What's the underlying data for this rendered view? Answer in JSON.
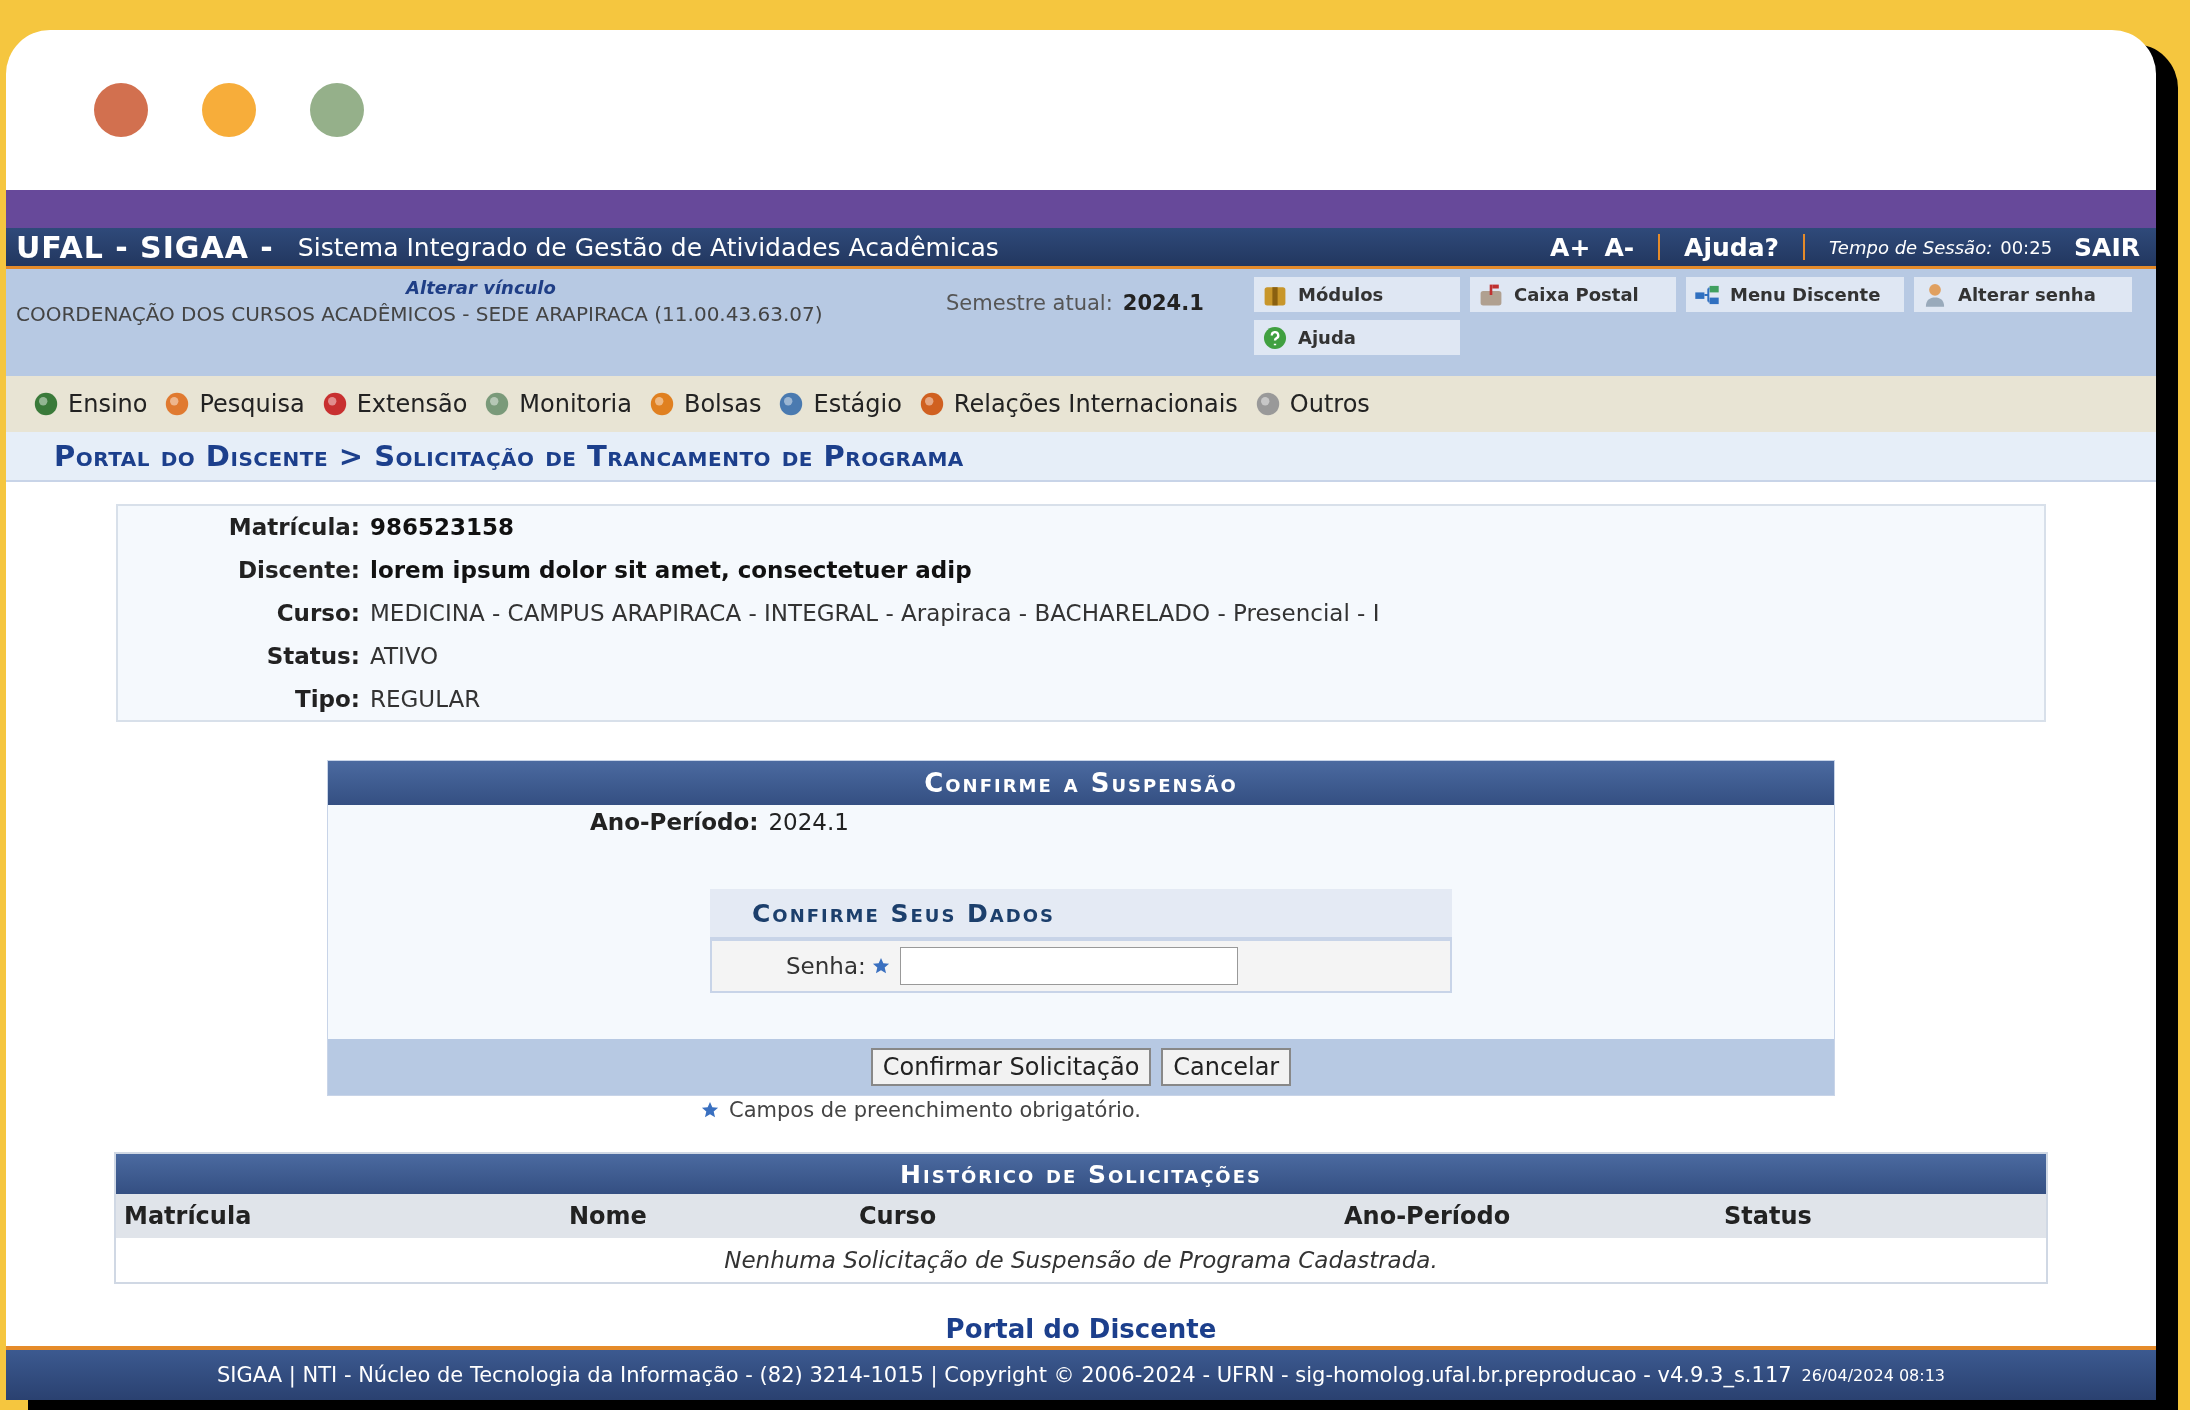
{
  "browser_frame": {
    "dots": [
      {
        "color": "#d2704f"
      },
      {
        "color": "#f7ad3a"
      },
      {
        "color": "#95b08a"
      }
    ]
  },
  "header": {
    "logo": "UFAL - SIGAA -",
    "subtitle": "Sistema Integrado de Gestão de Atividades Acadêmicas",
    "font_controls": [
      "A+",
      "A-"
    ],
    "help": "Ajuda?",
    "session_label": "Tempo de Sessão:",
    "session_time": "00:25",
    "logout": "SAIR"
  },
  "info_bar": {
    "change_link": "Alterar vínculo",
    "unit": "COORDENAÇÃO DOS CURSOS ACADÊMICOS - SEDE ARAPIRACA (11.00.43.63.07)",
    "semester_label": "Semestre atual:",
    "semester": "2024.1",
    "shortcuts": [
      {
        "label": "Módulos"
      },
      {
        "label": "Caixa Postal"
      },
      {
        "label": "Menu Discente"
      },
      {
        "label": "Alterar senha"
      },
      {
        "label": "Ajuda"
      }
    ]
  },
  "menu": [
    "Ensino",
    "Pesquisa",
    "Extensão",
    "Monitoria",
    "Bolsas",
    "Estágio",
    "Relações Internacionais",
    "Outros"
  ],
  "breadcrumb": "Portal do Discente > Solicitação de Trancamento de Programa",
  "student": [
    {
      "label": "Matrícula:",
      "value": "986523158"
    },
    {
      "label": "Discente:",
      "value": "lorem ipsum dolor sit amet, consectetuer adip"
    },
    {
      "label": "Curso:",
      "value": "MEDICINA - CAMPUS ARAPIRACA - INTEGRAL - Arapiraca - BACHARELADO - Presencial - I"
    },
    {
      "label": "Status:",
      "value": "ATIVO"
    },
    {
      "label": "Tipo:",
      "value": "REGULAR"
    }
  ],
  "confirm_panel": {
    "title": "Confirme a Suspensão",
    "period_label": "Ano-Período:",
    "period": "2024.1",
    "subpanel_title": "Confirme Seus Dados",
    "password_label": "Senha:",
    "buttons": [
      "Confirmar Solicitação",
      "Cancelar"
    ]
  },
  "required_note": "Campos de preenchimento obrigatório.",
  "history": {
    "title": "Histórico de Solicitações",
    "columns": [
      "Matrícula",
      "Nome",
      "Curso",
      "Ano-Período",
      "Status"
    ],
    "empty_message": "Nenhuma Solicitação de Suspensão de Programa Cadastrada."
  },
  "back_link": "Portal do Discente",
  "footer": {
    "text": "SIGAA | NTI - Núcleo de Tecnologia da Informação - (82) 3214-1015 | Copyright © 2006-2024 - UFRN - sig-homolog.ufal.br.preproducao - v4.9.3_s.117",
    "timestamp": "26/04/2024 08:13"
  }
}
